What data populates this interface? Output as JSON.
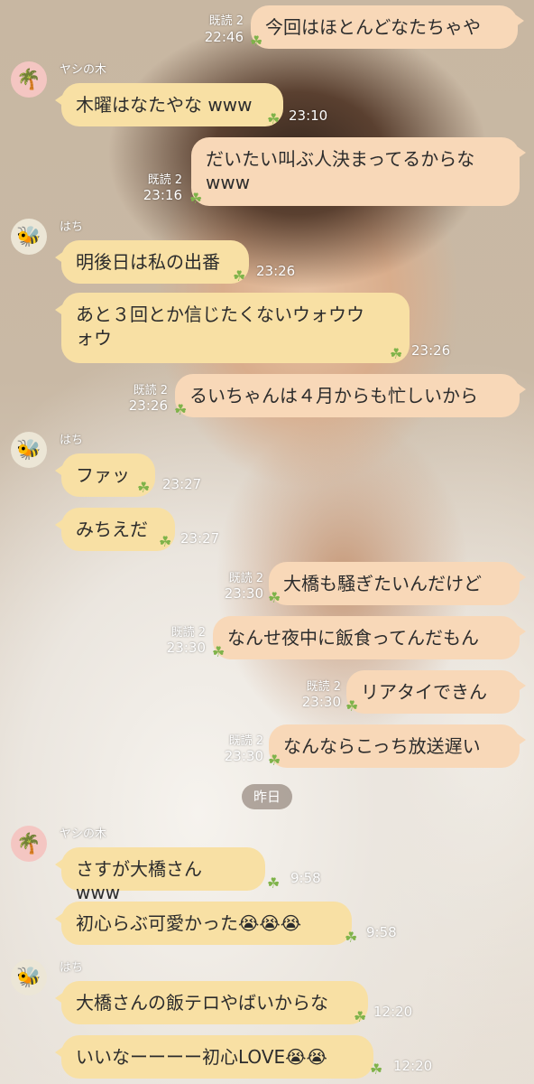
{
  "contacts": {
    "yashi": "ヤシの木",
    "hachi": "はち"
  },
  "read_label": "既読 2",
  "date_separator": "昨日",
  "messages": [
    {
      "text": "今回はほとんどなたちゃや",
      "time": "22:46"
    },
    {
      "text": "木曜はなたやな www",
      "time": "23:10"
    },
    {
      "text": "だいたい叫ぶ人決まってるからな\nwww",
      "time": "23:16"
    },
    {
      "text": "明後日は私の出番",
      "time": "23:26"
    },
    {
      "text": "あと３回とか信じたくないウォウウ\nォウ",
      "time": "23:26"
    },
    {
      "text": "るいちゃんは４月からも忙しいから",
      "time": "23:26"
    },
    {
      "text": "ファッ",
      "time": "23:27"
    },
    {
      "text": "みちえだ",
      "time": "23:27"
    },
    {
      "text": "大橋も騒ぎたいんだけど",
      "time": "23:30"
    },
    {
      "text": "なんせ夜中に飯食ってんだもん",
      "time": "23:30"
    },
    {
      "text": "リアタイできん",
      "time": "23:30"
    },
    {
      "text": "なんならこっち放送遅い",
      "time": "23:30"
    },
    {
      "text": "さすが大橋さん www",
      "time": "9:58"
    },
    {
      "text": "初心らぶ可愛かった😭😭😭",
      "time": "9:58"
    },
    {
      "text": "大橋さんの飯テロやばいからな",
      "time": "12:20"
    },
    {
      "text": "いいなーーーー初心LOVE😭😭",
      "time": "12:20"
    }
  ],
  "colors": {
    "incoming_bubble": "#f8e0a4",
    "outgoing_bubble": "#f8d8b8",
    "clover": "#7fb34a"
  },
  "icons": {
    "yashi_avatar": "palm-tree-icon",
    "hachi_avatar": "bee-icon",
    "read_marker": "clover-icon"
  }
}
